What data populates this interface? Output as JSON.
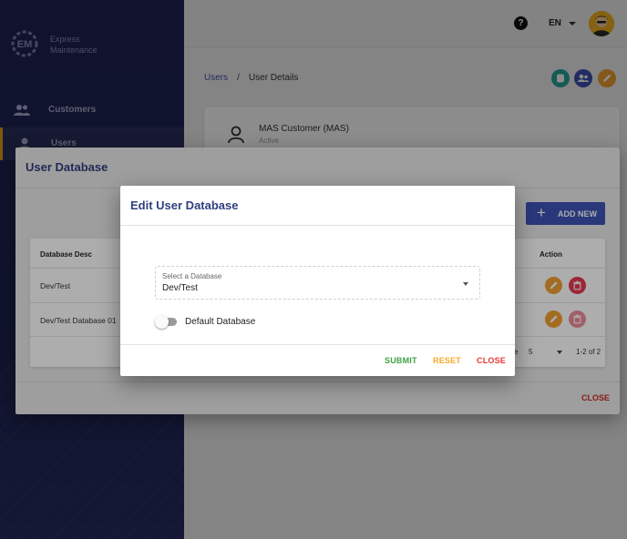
{
  "app": {
    "brand_line1": "Express",
    "brand_line2": "Maintenance"
  },
  "sidebar": {
    "items": [
      {
        "label": "Customers",
        "icon": "people-icon"
      },
      {
        "label": "Users",
        "icon": "user-icon"
      }
    ]
  },
  "topbar": {
    "language": "EN",
    "help_icon": "help-circle-icon"
  },
  "breadcrumb": {
    "parent": "Users",
    "separator": "/",
    "current": "User Details"
  },
  "user_card": {
    "name": "MAS Customer (MAS)",
    "status": "Active"
  },
  "user_db_dialog": {
    "title": "User Database",
    "add_new_label": "ADD NEW",
    "columns": {
      "desc": "Database Desc",
      "action": "Action"
    },
    "rows": [
      {
        "desc": "Dev/Test"
      },
      {
        "desc": "Dev/Test Database 01"
      }
    ],
    "pagination": {
      "rows_label_tail": "e",
      "rows_per_page": "5",
      "range": "1-2 of 2"
    },
    "close_label": "CLOSE"
  },
  "edit_dialog": {
    "title": "Edit User Database",
    "select": {
      "label": "Select a Database",
      "value": "Dev/Test"
    },
    "toggle_label": "Default Database",
    "default_enabled": false,
    "submit_label": "SUBMIT",
    "reset_label": "RESET",
    "close_label": "CLOSE"
  },
  "colors": {
    "primary": "#3f51b5",
    "teal": "#26a69a",
    "amber": "#f9a825",
    "orange": "#f0a030",
    "red": "#e53950",
    "green": "#43a047",
    "sidebar": "#1f2455"
  }
}
